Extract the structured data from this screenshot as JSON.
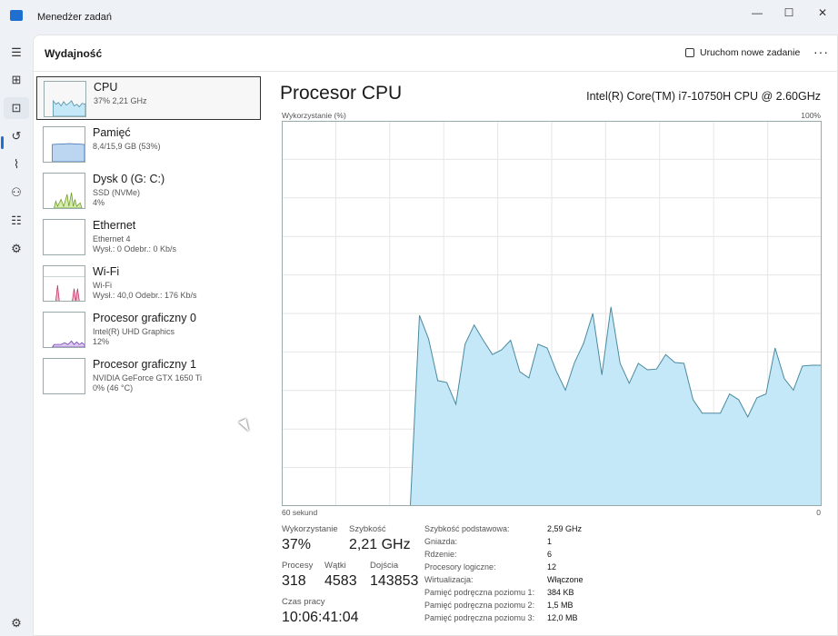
{
  "window": {
    "title": "Menedżer zadań",
    "minimize": "—",
    "maximize": "☐",
    "close": "✕"
  },
  "header": {
    "title": "Wydajność",
    "new_task": "Uruchom nowe zadanie",
    "more": "···"
  },
  "rail": [
    "☰",
    "⊞",
    "⊡",
    "↺",
    "⌇",
    "⚇",
    "☷",
    "⚙"
  ],
  "list": [
    {
      "name": "CPU",
      "sub1": "37% 2,21 GHz",
      "sub2": ""
    },
    {
      "name": "Pamięć",
      "sub1": "8,4/15,9 GB (53%)",
      "sub2": ""
    },
    {
      "name": "Dysk 0 (G: C:)",
      "sub1": "SSD (NVMe)",
      "sub2": "4%"
    },
    {
      "name": "Ethernet",
      "sub1": "Ethernet 4",
      "sub2": "Wysł.: 0 Odebr.: 0 Kb/s"
    },
    {
      "name": "Wi-Fi",
      "sub1": "Wi-Fi",
      "sub2": "Wysł.: 40,0 Odebr.: 176 Kb/s"
    },
    {
      "name": "Procesor graficzny 0",
      "sub1": "Intel(R) UHD Graphics",
      "sub2": "12%"
    },
    {
      "name": "Procesor graficzny 1",
      "sub1": "NVIDIA GeForce GTX 1650 Ti",
      "sub2": "0% (46 °C)"
    }
  ],
  "detail": {
    "title": "Procesor CPU",
    "model": "Intel(R) Core(TM) i7-10750H CPU @ 2.60GHz"
  },
  "chart_data": {
    "type": "area",
    "ylabel": "Wykorzystanie (%)",
    "ymax_label": "100%",
    "xlabel_left": "60 sekund",
    "xlabel_right": "0",
    "ylim": [
      0,
      100
    ],
    "samples": 60,
    "grid": {
      "cols": 10,
      "rows": 10
    },
    "color": "#c4e8f8",
    "line": "#4a8aa0",
    "values": [
      null,
      null,
      null,
      null,
      null,
      null,
      null,
      null,
      null,
      null,
      null,
      null,
      null,
      null,
      0,
      49.5,
      43.4,
      32.5,
      32,
      26.3,
      42,
      47,
      43,
      39.3,
      40.5,
      43,
      34.8,
      33.2,
      42,
      41,
      35,
      30,
      37.2,
      42.2,
      50,
      34,
      51.7,
      37,
      31.8,
      37,
      35.3,
      35.5,
      39.3,
      37.2,
      37,
      27.5,
      24,
      24,
      24,
      29,
      27.5,
      23,
      28,
      29,
      41,
      33,
      30,
      36.3,
      36.5,
      36.5
    ]
  },
  "stats": {
    "util_label": "Wykorzystanie",
    "util": "37%",
    "speed_label": "Szybkość",
    "speed": "2,21 GHz",
    "proc_label": "Procesy",
    "proc": "318",
    "threads_label": "Wątki",
    "threads": "4583",
    "handles_label": "Dojścia",
    "handles": "143853",
    "uptime_label": "Czas pracy",
    "uptime": "10:06:41:04"
  },
  "specs": [
    {
      "k": "Szybkość podstawowa:",
      "v": "2,59 GHz"
    },
    {
      "k": "Gniazda:",
      "v": "1"
    },
    {
      "k": "Rdzenie:",
      "v": "6"
    },
    {
      "k": "Procesory logiczne:",
      "v": "12"
    },
    {
      "k": "Wirtualizacja:",
      "v": "Włączone"
    },
    {
      "k": "Pamięć podręczna poziomu 1:",
      "v": "384 KB"
    },
    {
      "k": "Pamięć podręczna poziomu 2:",
      "v": "1,5 MB"
    },
    {
      "k": "Pamięć podręczna poziomu 3:",
      "v": "12,0 MB"
    }
  ]
}
